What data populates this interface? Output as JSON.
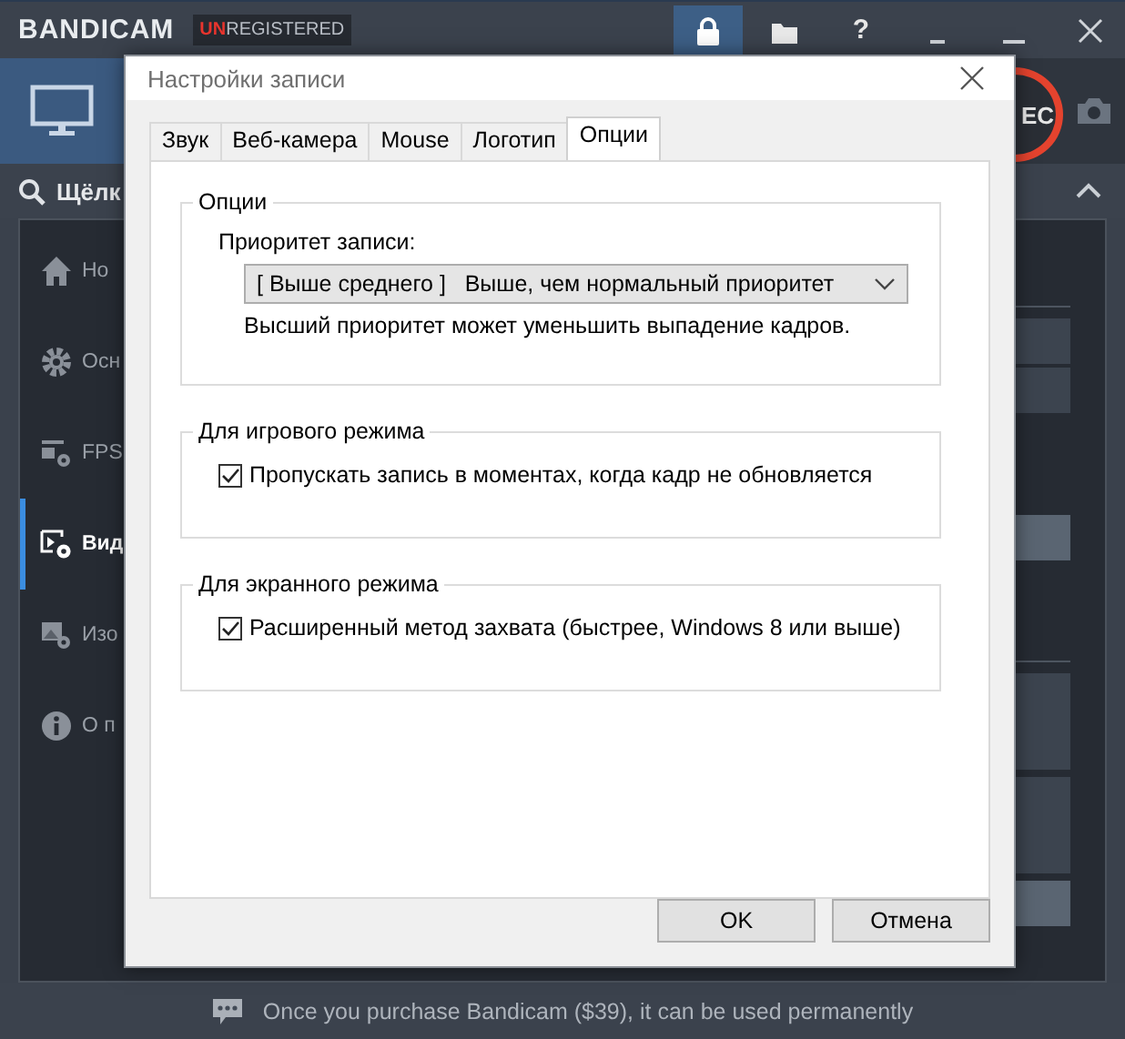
{
  "app": {
    "logo": "BANDICAM",
    "badge": {
      "highlight": "UN",
      "rest": "REGISTERED"
    },
    "toolbar": [
      {
        "kind": "lock",
        "selected": true
      },
      {
        "kind": "folder",
        "selected": false
      },
      {
        "kind": "help",
        "text": "?",
        "selected": false
      },
      {
        "kind": "minimize",
        "selected": false
      },
      {
        "kind": "maximize",
        "selected": false
      },
      {
        "kind": "close",
        "selected": false
      }
    ],
    "modes": [
      {
        "kind": "screen",
        "selected": true
      }
    ],
    "rec_label": "EC",
    "search": "Щёлк",
    "sidebar": [
      {
        "kind": "home",
        "label": "Ho",
        "selected": false
      },
      {
        "kind": "gear",
        "label": "Осн",
        "selected": false
      },
      {
        "kind": "fps",
        "label": "FPS",
        "selected": false
      },
      {
        "kind": "video",
        "label": "Вид",
        "selected": true
      },
      {
        "kind": "image",
        "label": "Изо",
        "selected": false
      },
      {
        "kind": "info",
        "label": "О п",
        "selected": false
      }
    ],
    "footer": "Once you purchase Bandicam ($39), it can be used permanently"
  },
  "dialog": {
    "title": "Настройки записи",
    "tabs": [
      {
        "label": "Звук",
        "selected": false
      },
      {
        "label": "Веб-камера",
        "selected": false
      },
      {
        "label": "Mouse",
        "selected": false
      },
      {
        "label": "Логотип",
        "selected": false
      },
      {
        "label": "Опции",
        "selected": true
      }
    ],
    "groups": [
      {
        "title": "Опции",
        "kind": "dropdown",
        "label": "Приоритет записи:",
        "value": "[ Выше среднего ]   Выше, чем нормальный приоритет",
        "hint": "Высший приоритет может уменьшить выпадение кадров."
      },
      {
        "title": "Для игрового режима",
        "kind": "checkbox",
        "label": "Пропускать запись в моментах, когда кадр не обновляется",
        "checked": true
      },
      {
        "title": "Для экранного режима",
        "kind": "checkbox",
        "label": "Расширенный метод захвата (быстрее, Windows 8 или выше)",
        "checked": true
      }
    ],
    "buttons": [
      "OK",
      "Отмена"
    ]
  }
}
